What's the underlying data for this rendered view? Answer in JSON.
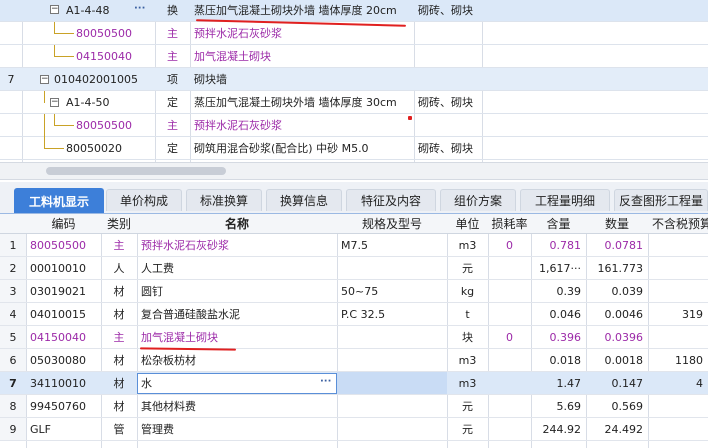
{
  "top_rows": [
    {
      "num": "",
      "code": "A1-4-48",
      "type": "换",
      "name": "蒸压加气混凝土砌块外墙 墙体厚度 20cm",
      "spec": "砌砖、砌块",
      "style": "sel",
      "dots": "···"
    },
    {
      "num": "",
      "code": "80050500",
      "type": "主",
      "name": "预拌水泥石灰砂浆",
      "spec": "",
      "style": "purple"
    },
    {
      "num": "",
      "code": "04150040",
      "type": "主",
      "name": "加气混凝土砌块",
      "spec": "",
      "style": "purple"
    },
    {
      "num": "7",
      "code": "010402001005",
      "type": "项",
      "name": "砌块墙",
      "spec": "",
      "style": "hl"
    },
    {
      "num": "",
      "code": "A1-4-50",
      "type": "定",
      "name": "蒸压加气混凝土砌块外墙 墙体厚度 30cm",
      "spec": "砌砖、砌块",
      "style": ""
    },
    {
      "num": "",
      "code": "80050500",
      "type": "主",
      "name": "预拌水泥石灰砂浆",
      "spec": "",
      "style": "purple"
    },
    {
      "num": "",
      "code": "80050020",
      "type": "定",
      "name": "砌筑用混合砂浆(配合比) 中砂 M5.0",
      "spec": "砌砖、砌块",
      "style": ""
    }
  ],
  "tabs": [
    "工料机显示",
    "单价构成",
    "标准换算",
    "换算信息",
    "特征及内容",
    "组价方案",
    "工程量明细",
    "反查图形工程量"
  ],
  "columns": [
    "编码",
    "类别",
    "名称",
    "规格及型号",
    "单位",
    "损耗率",
    "含量",
    "数量",
    "不含税预算"
  ],
  "rows": [
    {
      "num": "1",
      "code": "80050500",
      "type": "主",
      "name": "预拌水泥石灰砂浆",
      "spec": "M7.5",
      "unit": "m3",
      "loss": "0",
      "content": "0.781",
      "qty": "0.0781",
      "price": "",
      "style": "purple"
    },
    {
      "num": "2",
      "code": "00010010",
      "type": "人",
      "name": "人工费",
      "spec": "",
      "unit": "元",
      "loss": "",
      "content": "1,617···",
      "qty": "161.773",
      "price": "",
      "style": ""
    },
    {
      "num": "3",
      "code": "03019021",
      "type": "材",
      "name": "圆钉",
      "spec": "50~75",
      "unit": "kg",
      "loss": "",
      "content": "0.39",
      "qty": "0.039",
      "price": "",
      "style": ""
    },
    {
      "num": "4",
      "code": "04010015",
      "type": "材",
      "name": "复合普通硅酸盐水泥",
      "spec": "P.C 32.5",
      "unit": "t",
      "loss": "",
      "content": "0.046",
      "qty": "0.0046",
      "price": "319",
      "style": ""
    },
    {
      "num": "5",
      "code": "04150040",
      "type": "主",
      "name": "加气混凝土砌块",
      "spec": "",
      "unit": "块",
      "loss": "0",
      "content": "0.396",
      "qty": "0.0396",
      "price": "",
      "style": "purple"
    },
    {
      "num": "6",
      "code": "05030080",
      "type": "材",
      "name": "松杂板枋材",
      "spec": "",
      "unit": "m3",
      "loss": "",
      "content": "0.018",
      "qty": "0.0018",
      "price": "1180",
      "style": ""
    },
    {
      "num": "7",
      "code": "34110010",
      "type": "材",
      "name": "水",
      "spec": "",
      "unit": "m3",
      "loss": "",
      "content": "1.47",
      "qty": "0.147",
      "price": "4",
      "style": "sel",
      "dots": "···"
    },
    {
      "num": "8",
      "code": "99450760",
      "type": "材",
      "name": "其他材料费",
      "spec": "",
      "unit": "元",
      "loss": "",
      "content": "5.69",
      "qty": "0.569",
      "price": "",
      "style": ""
    },
    {
      "num": "9",
      "code": "GLF",
      "type": "管",
      "name": "管理费",
      "spec": "",
      "unit": "元",
      "loss": "",
      "content": "244.92",
      "qty": "24.492",
      "price": "",
      "style": ""
    }
  ],
  "colors": {
    "accent": "#3d7fd9",
    "main_material": "#9c2aa8",
    "annotation": "#e02020",
    "tree_line": "#c9a227"
  }
}
